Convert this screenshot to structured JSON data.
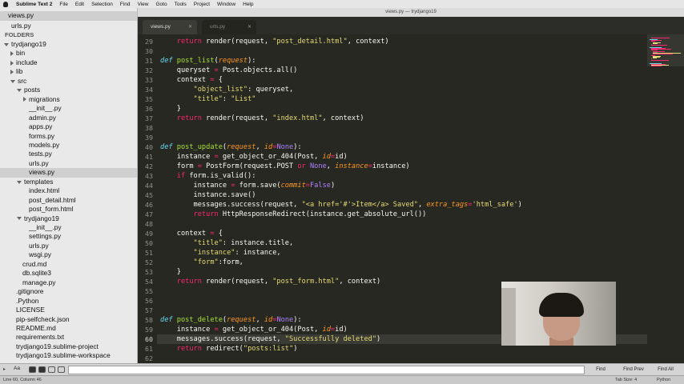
{
  "menubar": {
    "app": "Sublime Text 2",
    "items": [
      "File",
      "Edit",
      "Selection",
      "Find",
      "View",
      "Goto",
      "Tools",
      "Project",
      "Window",
      "Help"
    ]
  },
  "window": {
    "title": "views.py — trydjango19"
  },
  "tabs": [
    {
      "label": "views.py",
      "active": true
    },
    {
      "label": "urls.py",
      "active": false
    }
  ],
  "sidebar": {
    "open_files": [
      "views.py",
      "urls.py"
    ],
    "folders_label": "FOLDERS",
    "tree": [
      {
        "label": "trydjango19",
        "depth": 0,
        "arrow": "down"
      },
      {
        "label": "bin",
        "depth": 1,
        "arrow": "right"
      },
      {
        "label": "include",
        "depth": 1,
        "arrow": "right"
      },
      {
        "label": "lib",
        "depth": 1,
        "arrow": "right"
      },
      {
        "label": "src",
        "depth": 1,
        "arrow": "down"
      },
      {
        "label": "posts",
        "depth": 2,
        "arrow": "down"
      },
      {
        "label": "migrations",
        "depth": 3,
        "arrow": "right"
      },
      {
        "label": "__init__.py",
        "depth": 3,
        "arrow": ""
      },
      {
        "label": "admin.py",
        "depth": 3,
        "arrow": ""
      },
      {
        "label": "apps.py",
        "depth": 3,
        "arrow": ""
      },
      {
        "label": "forms.py",
        "depth": 3,
        "arrow": ""
      },
      {
        "label": "models.py",
        "depth": 3,
        "arrow": ""
      },
      {
        "label": "tests.py",
        "depth": 3,
        "arrow": ""
      },
      {
        "label": "urls.py",
        "depth": 3,
        "arrow": ""
      },
      {
        "label": "views.py",
        "depth": 3,
        "arrow": "",
        "selected": true
      },
      {
        "label": "templates",
        "depth": 2,
        "arrow": "down"
      },
      {
        "label": "index.html",
        "depth": 3,
        "arrow": ""
      },
      {
        "label": "post_detail.html",
        "depth": 3,
        "arrow": ""
      },
      {
        "label": "post_form.html",
        "depth": 3,
        "arrow": ""
      },
      {
        "label": "trydjango19",
        "depth": 2,
        "arrow": "down"
      },
      {
        "label": "__init__.py",
        "depth": 3,
        "arrow": ""
      },
      {
        "label": "settings.py",
        "depth": 3,
        "arrow": ""
      },
      {
        "label": "urls.py",
        "depth": 3,
        "arrow": ""
      },
      {
        "label": "wsgi.py",
        "depth": 3,
        "arrow": ""
      },
      {
        "label": "crud.md",
        "depth": 2,
        "arrow": ""
      },
      {
        "label": "db.sqlite3",
        "depth": 2,
        "arrow": ""
      },
      {
        "label": "manage.py",
        "depth": 2,
        "arrow": ""
      },
      {
        "label": ".gitignore",
        "depth": 1,
        "arrow": ""
      },
      {
        "label": ".Python",
        "depth": 1,
        "arrow": ""
      },
      {
        "label": "LICENSE",
        "depth": 1,
        "arrow": ""
      },
      {
        "label": "pip-selfcheck.json",
        "depth": 1,
        "arrow": ""
      },
      {
        "label": "README.md",
        "depth": 1,
        "arrow": ""
      },
      {
        "label": "requirements.txt",
        "depth": 1,
        "arrow": ""
      },
      {
        "label": "trydjango19.sublime-project",
        "depth": 1,
        "arrow": ""
      },
      {
        "label": "trydjango19.sublime-workspace",
        "depth": 1,
        "arrow": ""
      }
    ]
  },
  "editor": {
    "current_line": 60,
    "lines": [
      {
        "n": 29,
        "tokens": [
          [
            "    ",
            ""
          ],
          [
            "return",
            "kw"
          ],
          [
            " render(request, ",
            ""
          ],
          [
            "\"post_detail.html\"",
            "st"
          ],
          [
            ", context)",
            ""
          ]
        ]
      },
      {
        "n": 30,
        "tokens": []
      },
      {
        "n": 31,
        "tokens": [
          [
            "def",
            "df"
          ],
          [
            " ",
            ""
          ],
          [
            "post_list",
            "fn"
          ],
          [
            "(",
            ""
          ],
          [
            "request",
            "pr"
          ],
          [
            "):",
            ""
          ]
        ]
      },
      {
        "n": 32,
        "tokens": [
          [
            "    queryset ",
            ""
          ],
          [
            "=",
            "op"
          ],
          [
            " Post.objects.all()",
            ""
          ]
        ]
      },
      {
        "n": 33,
        "tokens": [
          [
            "    context ",
            ""
          ],
          [
            "=",
            "op"
          ],
          [
            " {",
            ""
          ]
        ]
      },
      {
        "n": 34,
        "tokens": [
          [
            "        ",
            ""
          ],
          [
            "\"object_list\"",
            "st"
          ],
          [
            ": queryset,",
            ""
          ]
        ]
      },
      {
        "n": 35,
        "tokens": [
          [
            "        ",
            ""
          ],
          [
            "\"title\"",
            "st"
          ],
          [
            ": ",
            ""
          ],
          [
            "\"List\"",
            "st"
          ]
        ]
      },
      {
        "n": 36,
        "tokens": [
          [
            "    }",
            ""
          ]
        ]
      },
      {
        "n": 37,
        "tokens": [
          [
            "    ",
            ""
          ],
          [
            "return",
            "kw"
          ],
          [
            " render(request, ",
            ""
          ],
          [
            "\"index.html\"",
            "st"
          ],
          [
            ", context)",
            ""
          ]
        ]
      },
      {
        "n": 38,
        "tokens": []
      },
      {
        "n": 39,
        "tokens": []
      },
      {
        "n": 40,
        "tokens": [
          [
            "def",
            "df"
          ],
          [
            " ",
            ""
          ],
          [
            "post_update",
            "fn"
          ],
          [
            "(",
            ""
          ],
          [
            "request",
            "pr"
          ],
          [
            ", ",
            ""
          ],
          [
            "id",
            "pr"
          ],
          [
            "=",
            "op"
          ],
          [
            "None",
            "nn"
          ],
          [
            "):",
            ""
          ]
        ]
      },
      {
        "n": 41,
        "tokens": [
          [
            "    instance ",
            ""
          ],
          [
            "=",
            "op"
          ],
          [
            " get_object_or_404(Post, ",
            ""
          ],
          [
            "id",
            "pr"
          ],
          [
            "=",
            "op"
          ],
          [
            "id)",
            ""
          ]
        ]
      },
      {
        "n": 42,
        "tokens": [
          [
            "    form ",
            ""
          ],
          [
            "=",
            "op"
          ],
          [
            " PostForm(request.POST ",
            ""
          ],
          [
            "or",
            "kw"
          ],
          [
            " ",
            ""
          ],
          [
            "None",
            "nn"
          ],
          [
            ", ",
            ""
          ],
          [
            "instance",
            "pr"
          ],
          [
            "=",
            "op"
          ],
          [
            "instance)",
            ""
          ]
        ]
      },
      {
        "n": 43,
        "tokens": [
          [
            "    ",
            ""
          ],
          [
            "if",
            "kw"
          ],
          [
            " form.is_valid():",
            ""
          ]
        ]
      },
      {
        "n": 44,
        "tokens": [
          [
            "        instance ",
            ""
          ],
          [
            "=",
            "op"
          ],
          [
            " form.save(",
            ""
          ],
          [
            "commit",
            "pr"
          ],
          [
            "=",
            "op"
          ],
          [
            "False",
            "nn"
          ],
          [
            ")",
            ""
          ]
        ]
      },
      {
        "n": 45,
        "tokens": [
          [
            "        instance.save()",
            ""
          ]
        ]
      },
      {
        "n": 46,
        "tokens": [
          [
            "        messages.success(request, ",
            ""
          ],
          [
            "\"<a href='#'>Item</a> Saved\"",
            "st"
          ],
          [
            ", ",
            ""
          ],
          [
            "extra_tags",
            "pr"
          ],
          [
            "=",
            "op"
          ],
          [
            "'html_safe'",
            "st"
          ],
          [
            ")",
            ""
          ]
        ]
      },
      {
        "n": 47,
        "tokens": [
          [
            "        ",
            ""
          ],
          [
            "return",
            "kw"
          ],
          [
            " HttpResponseRedirect(instance.get_absolute_url())",
            ""
          ]
        ]
      },
      {
        "n": 48,
        "tokens": []
      },
      {
        "n": 49,
        "tokens": [
          [
            "    context ",
            ""
          ],
          [
            "=",
            "op"
          ],
          [
            " {",
            ""
          ]
        ]
      },
      {
        "n": 50,
        "tokens": [
          [
            "        ",
            ""
          ],
          [
            "\"title\"",
            "st"
          ],
          [
            ": instance.title,",
            ""
          ]
        ]
      },
      {
        "n": 51,
        "tokens": [
          [
            "        ",
            ""
          ],
          [
            "\"instance\"",
            "st"
          ],
          [
            ": instance,",
            ""
          ]
        ]
      },
      {
        "n": 52,
        "tokens": [
          [
            "        ",
            ""
          ],
          [
            "\"form\"",
            "st"
          ],
          [
            ":form,",
            ""
          ]
        ]
      },
      {
        "n": 53,
        "tokens": [
          [
            "    }",
            ""
          ]
        ]
      },
      {
        "n": 54,
        "tokens": [
          [
            "    ",
            ""
          ],
          [
            "return",
            "kw"
          ],
          [
            " render(request, ",
            ""
          ],
          [
            "\"post_form.html\"",
            "st"
          ],
          [
            ", context)",
            ""
          ]
        ]
      },
      {
        "n": 55,
        "tokens": []
      },
      {
        "n": 56,
        "tokens": []
      },
      {
        "n": 57,
        "tokens": []
      },
      {
        "n": 58,
        "tokens": [
          [
            "def",
            "df"
          ],
          [
            " ",
            ""
          ],
          [
            "post_delete",
            "fn"
          ],
          [
            "(",
            ""
          ],
          [
            "request",
            "pr"
          ],
          [
            ", ",
            ""
          ],
          [
            "id",
            "pr"
          ],
          [
            "=",
            "op"
          ],
          [
            "None",
            "nn"
          ],
          [
            "):",
            ""
          ]
        ]
      },
      {
        "n": 59,
        "tokens": [
          [
            "    instance ",
            ""
          ],
          [
            "=",
            "op"
          ],
          [
            " get_object_or_404(Post, ",
            ""
          ],
          [
            "id",
            "pr"
          ],
          [
            "=",
            "op"
          ],
          [
            "id)",
            ""
          ]
        ]
      },
      {
        "n": 60,
        "tokens": [
          [
            "    messages.success(request, ",
            ""
          ],
          [
            "\"Successfully deleted\"",
            "st"
          ],
          [
            ")",
            ""
          ]
        ]
      },
      {
        "n": 61,
        "tokens": [
          [
            "    ",
            ""
          ],
          [
            "return",
            "kw"
          ],
          [
            " redirect(",
            ""
          ],
          [
            "\"posts:list\"",
            "st"
          ],
          [
            ")",
            ""
          ]
        ]
      },
      {
        "n": 62,
        "tokens": []
      }
    ]
  },
  "findbar": {
    "case_option": "Aa",
    "buttons": [
      "Find",
      "Find Prev",
      "Find All"
    ]
  },
  "statusbar": {
    "position": "Line 60, Column 46",
    "tab_size": "Tab Size: 4",
    "syntax": "Python"
  },
  "colors": {
    "keyword": "#f92672",
    "function": "#a6e22e",
    "string": "#e6db74",
    "param": "#fd971f",
    "constant": "#ae81ff",
    "def": "#66d9ef",
    "background": "#272822"
  }
}
